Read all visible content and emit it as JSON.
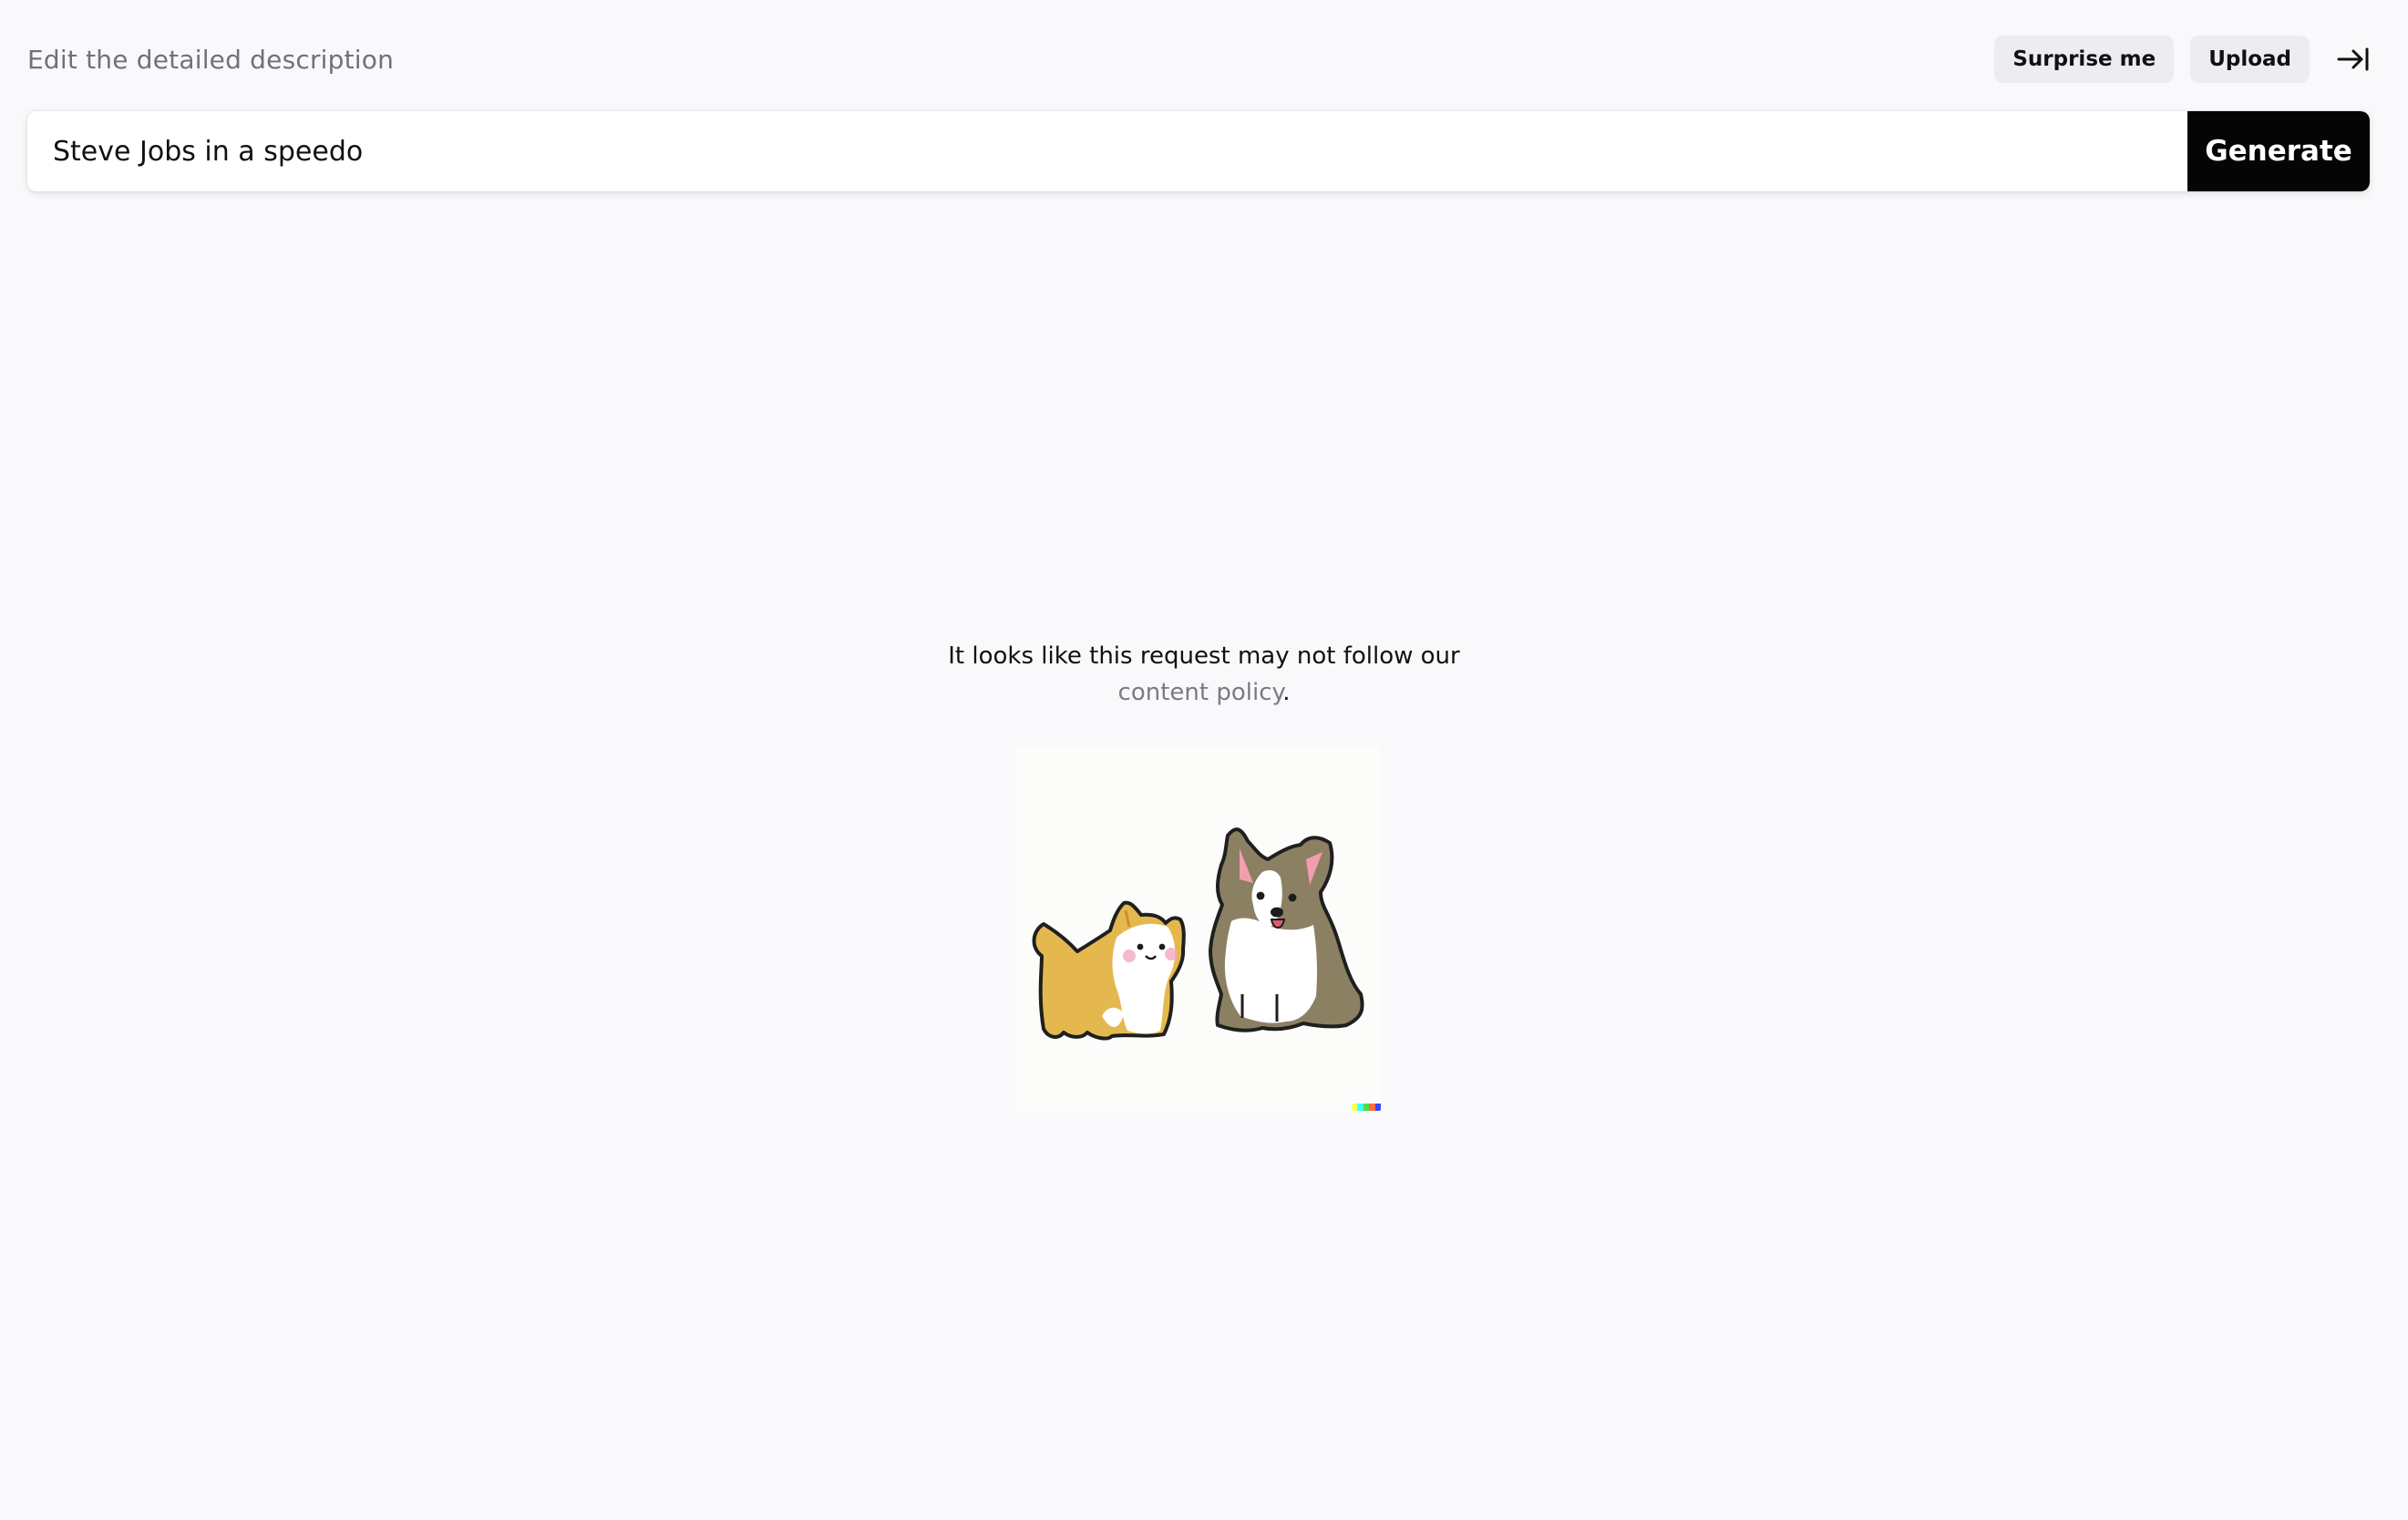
{
  "header": {
    "subtitle": "Edit the detailed description",
    "surprise_label": "Surprise me",
    "upload_label": "Upload",
    "collapse_icon": "arrow-right-bar-icon"
  },
  "prompt": {
    "value": "Steve Jobs in a speedo",
    "generate_label": "Generate"
  },
  "message": {
    "line1": "It looks like this request may not follow our",
    "link_text": "content policy",
    "suffix": "."
  },
  "illustration": {
    "name": "corgi-puppies-illustration",
    "signature_colors": [
      "#ffff66",
      "#42ffff",
      "#51da4c",
      "#ff6e3c",
      "#3c46ff"
    ]
  }
}
